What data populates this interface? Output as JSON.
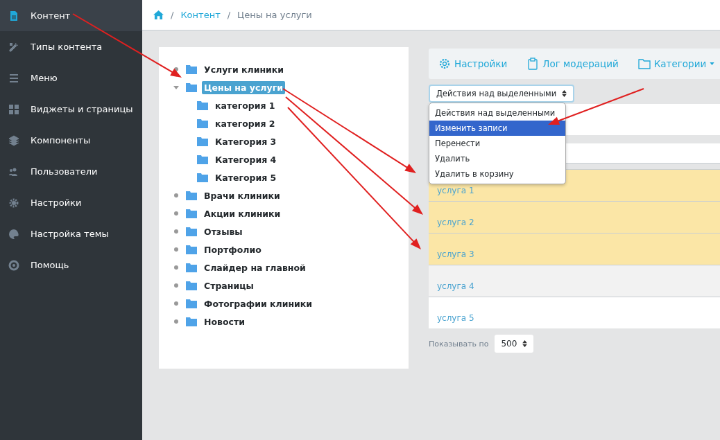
{
  "sidebar": {
    "items": [
      {
        "label": "Контент",
        "selected": true
      },
      {
        "label": "Типы контента",
        "selected": false
      },
      {
        "label": "Меню",
        "selected": false
      },
      {
        "label": "Виджеты и страницы",
        "selected": false
      },
      {
        "label": "Компоненты",
        "selected": false
      },
      {
        "label": "Пользователи",
        "selected": false
      },
      {
        "label": "Настройки",
        "selected": false
      },
      {
        "label": "Настройка темы",
        "selected": false
      },
      {
        "label": "Помощь",
        "selected": false
      }
    ]
  },
  "breadcrumb": {
    "link": "Контент",
    "separator": "/",
    "current": "Цены на услуги"
  },
  "tree": {
    "items": [
      {
        "label": "Услуги клиники",
        "selected": false,
        "expanded": false
      },
      {
        "label": "Цены на услуги",
        "selected": true,
        "expanded": true,
        "children": [
          {
            "label": "категория 1",
            "selected": false
          },
          {
            "label": "категория 2",
            "selected": false
          },
          {
            "label": "Категория 3",
            "selected": false
          },
          {
            "label": "Категория 4",
            "selected": false
          },
          {
            "label": "Категория 5",
            "selected": false
          }
        ]
      },
      {
        "label": "Врачи клиники",
        "selected": false,
        "expanded": false
      },
      {
        "label": "Акции клиники",
        "selected": false,
        "expanded": false
      },
      {
        "label": "Отзывы",
        "selected": false,
        "expanded": false
      },
      {
        "label": "Портфолио",
        "selected": false,
        "expanded": false
      },
      {
        "label": "Слайдер на главной",
        "selected": false,
        "expanded": false
      },
      {
        "label": "Страницы",
        "selected": false,
        "expanded": false
      },
      {
        "label": "Фотографии клиники",
        "selected": false,
        "expanded": false
      },
      {
        "label": "Новости",
        "selected": false,
        "expanded": false
      }
    ]
  },
  "toolbar": {
    "buttons": [
      "Настройки",
      "Лог модераций",
      "Категории"
    ]
  },
  "bulk_action": {
    "value": "Действия над выделенными",
    "expanded": true,
    "options": [
      {
        "label": "Действия над выделенными",
        "highlighted": false
      },
      {
        "label": "Изменить записи",
        "highlighted": true
      },
      {
        "label": "Перенести",
        "highlighted": false
      },
      {
        "label": "Удалить",
        "highlighted": false
      },
      {
        "label": "Удалить в корзину",
        "highlighted": false
      }
    ]
  },
  "table": {
    "rows": [
      {
        "title": "услуга 1",
        "selected": true
      },
      {
        "title": "услуга 2",
        "selected": true
      },
      {
        "title": "услуга 3",
        "selected": true
      },
      {
        "title": "услуга 4",
        "selected": false
      },
      {
        "title": "услуга 5",
        "selected": false
      }
    ]
  },
  "pagination": {
    "label": "Показывать по",
    "value": "500"
  }
}
